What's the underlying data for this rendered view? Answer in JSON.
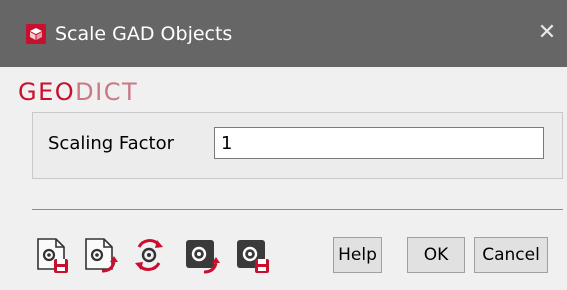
{
  "window": {
    "title": "Scale GAD Objects",
    "close_glyph": "✕",
    "app_icon": "geodict-cube-icon"
  },
  "brand": {
    "part1": "GEO",
    "part2": "DICT"
  },
  "form": {
    "scaling_factor_label": "Scaling Factor",
    "scaling_factor_value": "1"
  },
  "toolbar": {
    "icons": [
      "load-settings-icon",
      "save-settings-icon",
      "reset-settings-icon",
      "save-macro-icon",
      "load-macro-icon"
    ]
  },
  "buttons": {
    "help": "Help",
    "ok": "OK",
    "cancel": "Cancel"
  },
  "colors": {
    "accent": "#c8102e",
    "titlebar": "#666666"
  }
}
